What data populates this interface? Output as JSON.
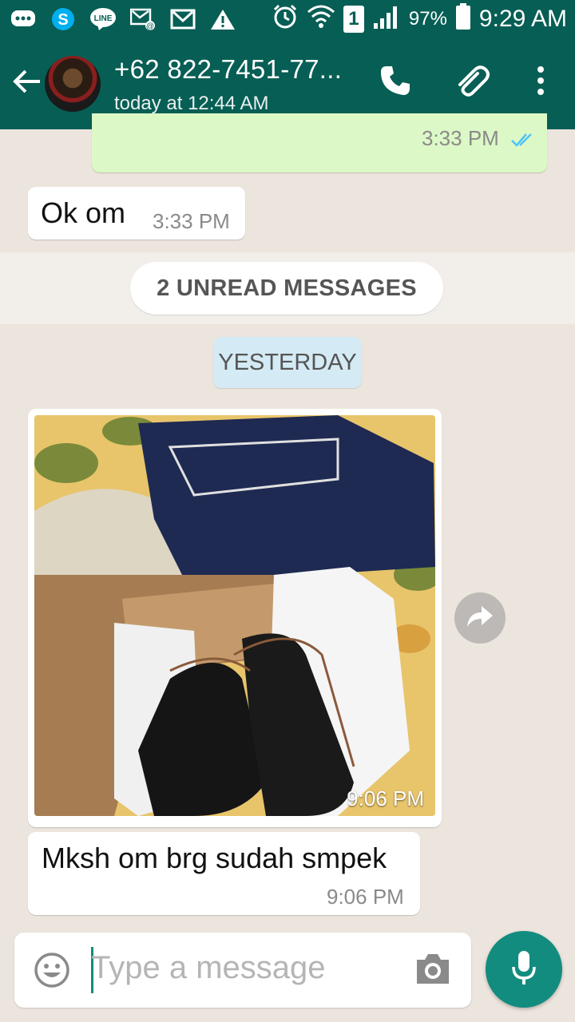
{
  "status_bar": {
    "icons": [
      "chat-icon",
      "skype-icon",
      "line-icon",
      "missed-call-icon",
      "gmail-icon",
      "warning-icon",
      "alarm-icon",
      "wifi-icon",
      "sim-icon",
      "signal-icon",
      "battery-icon"
    ],
    "sim_label": "1",
    "battery_percent": "97%",
    "time": "9:29 AM",
    "line_label": "LINE"
  },
  "header": {
    "title": "+62 822-7451-77...",
    "subtitle": "today at 12:44 AM"
  },
  "messages": [
    {
      "type": "outgoing",
      "time": "3:33 PM",
      "status": "read"
    },
    {
      "type": "incoming",
      "text": "Ok om",
      "time": "3:33 PM"
    }
  ],
  "unread_banner": "2 UNREAD MESSAGES",
  "date_separator": "YESTERDAY",
  "image_message": {
    "time": "9:06 PM"
  },
  "text_message": {
    "text": "Mksh om brg sudah smpek",
    "time": "9:06 PM"
  },
  "input": {
    "placeholder": "Type a message"
  },
  "colors": {
    "header": "#075e54",
    "accent": "#128c7e",
    "outgoing_bubble": "#dcf8c6",
    "read_ticks": "#4fc3f7",
    "date_pill": "#d4eaf4"
  }
}
